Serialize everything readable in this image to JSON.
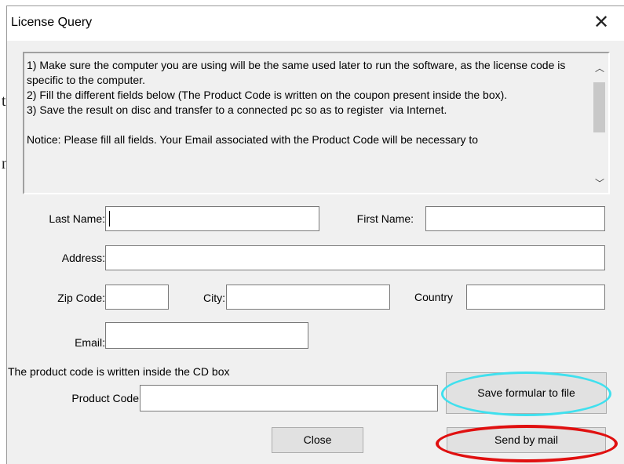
{
  "window": {
    "title": "License Query",
    "close_glyph": "✕"
  },
  "instructions": {
    "text": "1) Make sure the computer you are using will be the same used later to run the software, as the license code is specific to the computer.\n2) Fill the different fields below (The Product Code is written on the coupon present inside the box).\n3) Save the result on disc and transfer to a connected pc so as to register  via Internet.\n\nNotice: Please fill all fields. Your Email associated with the Product Code will be necessary to",
    "scroll_up": "︿",
    "scroll_down": "﹀"
  },
  "form": {
    "last_name_label": "Last Name:",
    "first_name_label": "First Name:",
    "address_label": "Address:",
    "zip_label": "Zip Code:",
    "city_label": "City:",
    "country_label": "Country",
    "email_label": "Email:",
    "product_note": "The product code is written inside the CD box",
    "product_code_label": "Product Code"
  },
  "buttons": {
    "save": "Save formular to file",
    "close": "Close",
    "send": "Send by mail"
  },
  "annotations": {
    "save_ring_color": "#3fe0ee",
    "send_ring_color": "#e01010"
  }
}
